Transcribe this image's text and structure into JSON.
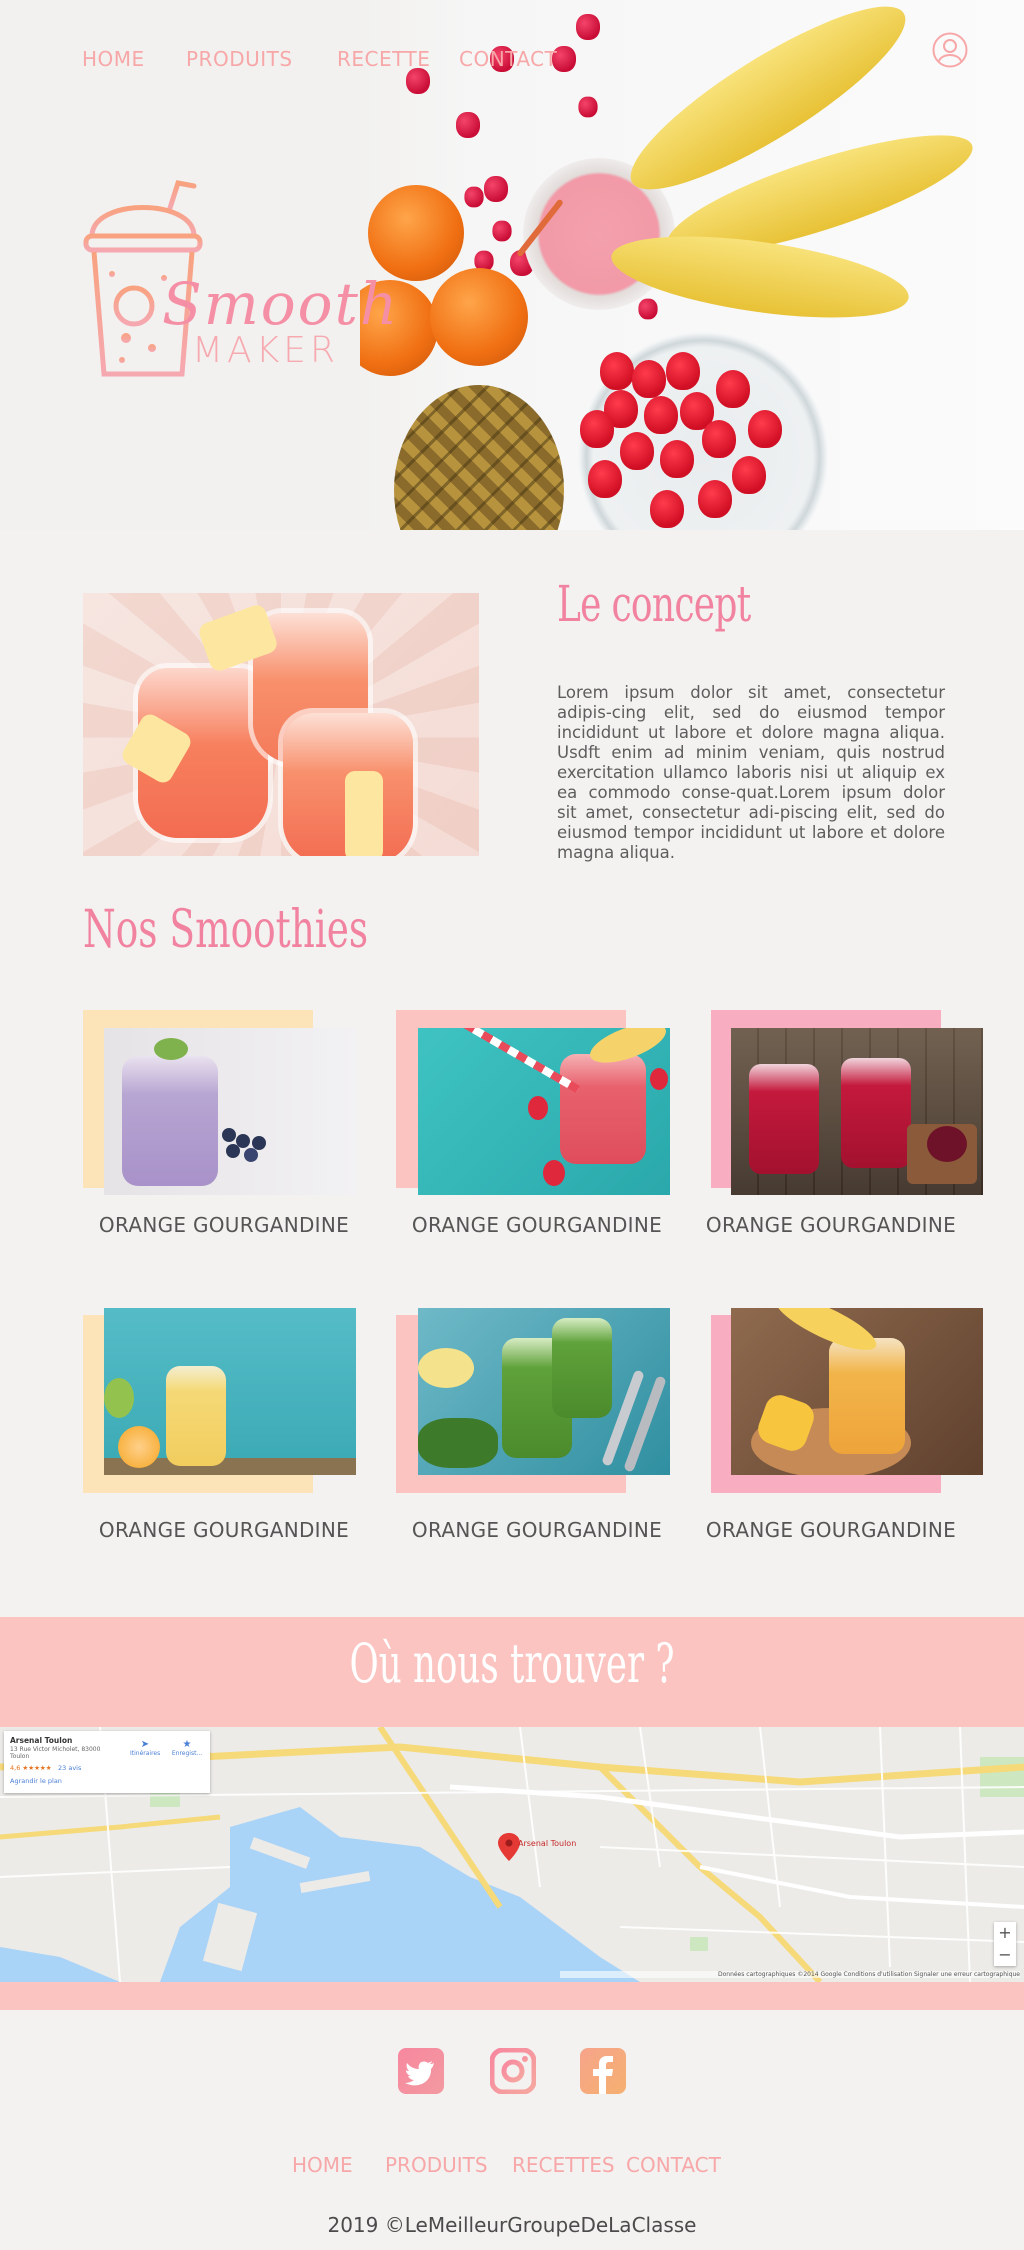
{
  "nav": {
    "links": [
      "HOME",
      "PRODUITS",
      "RECETTE",
      "CONTACT"
    ]
  },
  "logo": {
    "script_text": "Smooth",
    "word_text": "MAKER"
  },
  "concept": {
    "title": "Le concept",
    "body": "Lorem ipsum dolor sit amet, consectetur adipis-cing elit, sed do eiusmod tempor incididunt ut labore et dolore magna aliqua. Usdft enim ad minim veniam, quis nostrud exercitation ullamco laboris nisi ut aliquip ex ea commodo conse-quat.Lorem ipsum dolor sit amet, consectetur adi-piscing elit, sed do eiusmod tempor incididunt ut labore et dolore magna aliqua."
  },
  "smoothies": {
    "title": "Nos Smoothies",
    "cards": [
      {
        "label": "ORANGE GOURGANDINE"
      },
      {
        "label": "ORANGE GOURGANDINE"
      },
      {
        "label": "ORANGE GOURGANDINE"
      },
      {
        "label": "ORANGE GOURGANDINE"
      },
      {
        "label": "ORANGE GOURGANDINE"
      },
      {
        "label": "ORANGE GOURGANDINE"
      }
    ]
  },
  "location": {
    "title": "Où nous trouver ?",
    "map_card": {
      "place": "Arsenal Toulon",
      "address": "13 Rue Victor Micholet, 83000 Toulon",
      "rating": "4,6",
      "reviews": "23 avis",
      "directions": "Itinéraires",
      "save": "Enregist...",
      "enlarge": "Agrandir le plan"
    },
    "map_marker": "Arsenal Toulon",
    "map_footer": "Données cartographiques ©2014 Google   Conditions d'utilisation   Signaler une erreur cartographique"
  },
  "footer": {
    "links": [
      "HOME",
      "PRODUITS",
      "RECETTES",
      "CONTACT"
    ],
    "copyright": "2019 ©LeMeilleurGroupeDeLaClasse"
  },
  "colors": {
    "accent": "#f283a0",
    "nav": "#f7a7a8",
    "band": "#fbc4c0",
    "yellow_card": "#fde3b8",
    "pink_card": "#fbc4c0",
    "deep_pink_card": "#f8adc0"
  },
  "icons": [
    "user-icon",
    "twitter-icon",
    "instagram-icon",
    "facebook-icon"
  ]
}
